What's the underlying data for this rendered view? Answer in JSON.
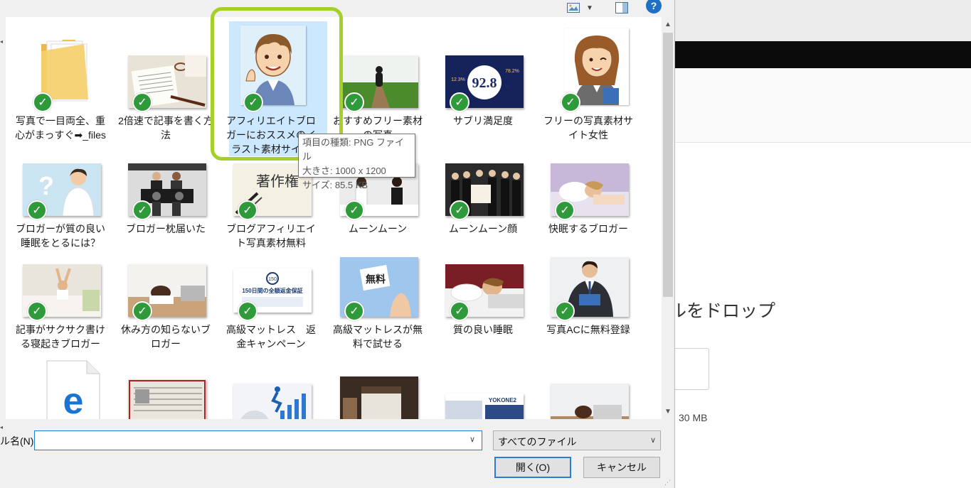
{
  "dialog": {
    "filename_label": "ル名(N):",
    "filename_value": "",
    "filter_value": "すべてのファイル",
    "open_button": "開く(O)",
    "cancel_button": "キャンセル",
    "help_icon": "?",
    "tooltip": {
      "type_line": "項目の種類: PNG ファイル",
      "size_line": "大きさ: 1000 x 1200",
      "filesize_line": "サイズ: 85.5 KB"
    },
    "files": [
      {
        "label": "写真で一目両全、重心がまっすぐ➡_files"
      },
      {
        "label": "2倍速で記事を書く方法"
      },
      {
        "label": "アフィリエイトブロガーにおススメのイラスト素材サイト"
      },
      {
        "label": "おすすめフリー素材の写真"
      },
      {
        "label": "サブリ満足度"
      },
      {
        "label": "フリーの写真素材サイト女性"
      },
      {
        "label": "ブロガーが質の良い睡眠をとるには？"
      },
      {
        "label": "ブロガー枕届いた"
      },
      {
        "label": "ブログアフィリエイト写真素材無料"
      },
      {
        "label": "ムーンムーン"
      },
      {
        "label": "ムーンムーン顔"
      },
      {
        "label": "快眠するブロガー"
      },
      {
        "label": "記事がサクサク書ける寝起きブロガー"
      },
      {
        "label": "休み方の知らないブロガー"
      },
      {
        "label": "高級マットレス　返金キャンペーン"
      },
      {
        "label": "高級マットレスが無料で試せる"
      },
      {
        "label": "質の良い睡眠"
      },
      {
        "label": "写真ACに無料登録"
      },
      {
        "label": ""
      },
      {
        "label": ""
      },
      {
        "label": ""
      },
      {
        "label": ""
      },
      {
        "label": ""
      },
      {
        "label": ""
      }
    ],
    "thumb_text": {
      "sub_big": "92.8",
      "sub_pct": "%",
      "sub_left": "12.3%",
      "sub_right": "78.2%",
      "copyright_word": "著作権",
      "free_word": "無料",
      "campaign_title": "150日間の全額返金保証",
      "campaign_badge": "150",
      "yokone": "YOKONE2"
    }
  },
  "background_page": {
    "drop_text": "ルをドロップ",
    "size_limit": "30 MB"
  },
  "colors": {
    "selection_highlight": "#a6cf28",
    "selection_bg": "#cce8ff",
    "check_green": "#2f9a3a",
    "accent_blue": "#1e7fd6"
  }
}
